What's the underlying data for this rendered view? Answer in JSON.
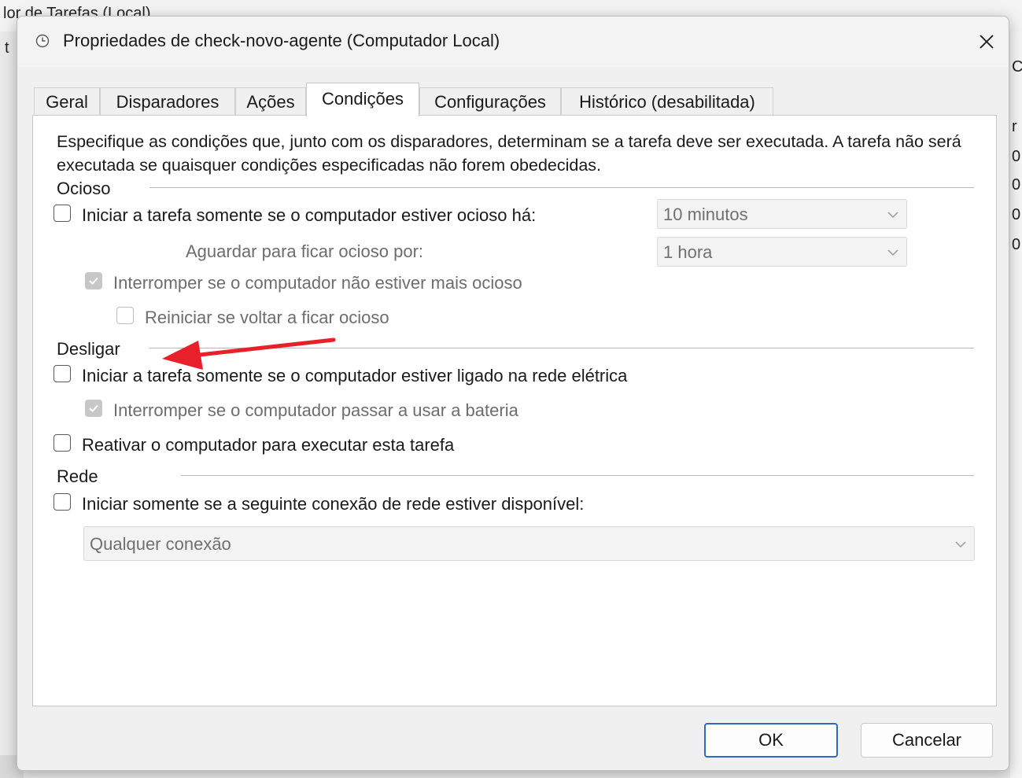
{
  "background": {
    "window_title_fragment": "lor de Tarefas (Local)",
    "left_fragment": "t",
    "right_fragments": [
      "C",
      "r",
      "0",
      "0",
      "0",
      "0"
    ]
  },
  "dialog": {
    "title": "Propriedades de check-novo-agente (Computador Local)",
    "title_icon": "clock-icon",
    "close_icon": "close-icon"
  },
  "tabs": [
    {
      "label": "Geral",
      "active": false
    },
    {
      "label": "Disparadores",
      "active": false
    },
    {
      "label": "Ações",
      "active": false
    },
    {
      "label": "Condições",
      "active": true
    },
    {
      "label": "Configurações",
      "active": false
    },
    {
      "label": "Histórico (desabilitada)",
      "active": false
    }
  ],
  "description": "Especifique as condições que, junto com os disparadores, determinam se a tarefa deve ser executada. A tarefa não será executada se quaisquer condições especificadas não forem obedecidas.",
  "idle": {
    "group_label": "Ocioso",
    "start_if_idle": {
      "label": "Iniciar a tarefa somente se o computador estiver ocioso há:",
      "checked": false
    },
    "idle_duration": {
      "value": "10 minutos"
    },
    "wait_label": "Aguardar para ficar ocioso por:",
    "wait_duration": {
      "value": "1 hora"
    },
    "stop_if_not_idle": {
      "label": "Interromper se o computador não estiver mais ocioso",
      "checked": true,
      "disabled": true
    },
    "restart_if_idle": {
      "label": "Reiniciar se voltar a ficar ocioso",
      "checked": false,
      "disabled": true
    }
  },
  "power": {
    "group_label": "Desligar",
    "start_on_ac": {
      "label": "Iniciar a tarefa somente se o computador estiver ligado na rede elétrica",
      "checked": false
    },
    "stop_on_battery": {
      "label": "Interromper se o computador passar a usar a bateria",
      "checked": true,
      "disabled": true
    },
    "wake_to_run": {
      "label": "Reativar o computador para executar esta tarefa",
      "checked": false
    }
  },
  "network": {
    "group_label": "Rede",
    "start_if_network": {
      "label": "Iniciar somente se a seguinte conexão de rede estiver disponível:",
      "checked": false
    },
    "connection": {
      "value": "Qualquer conexão"
    }
  },
  "buttons": {
    "ok": "OK",
    "cancel": "Cancelar"
  },
  "annotation": {
    "arrow_color": "#e8202a"
  },
  "colors": {
    "accent": "#2d6cc0",
    "panel": "#ffffff",
    "dialog": "#f0f0f0"
  }
}
